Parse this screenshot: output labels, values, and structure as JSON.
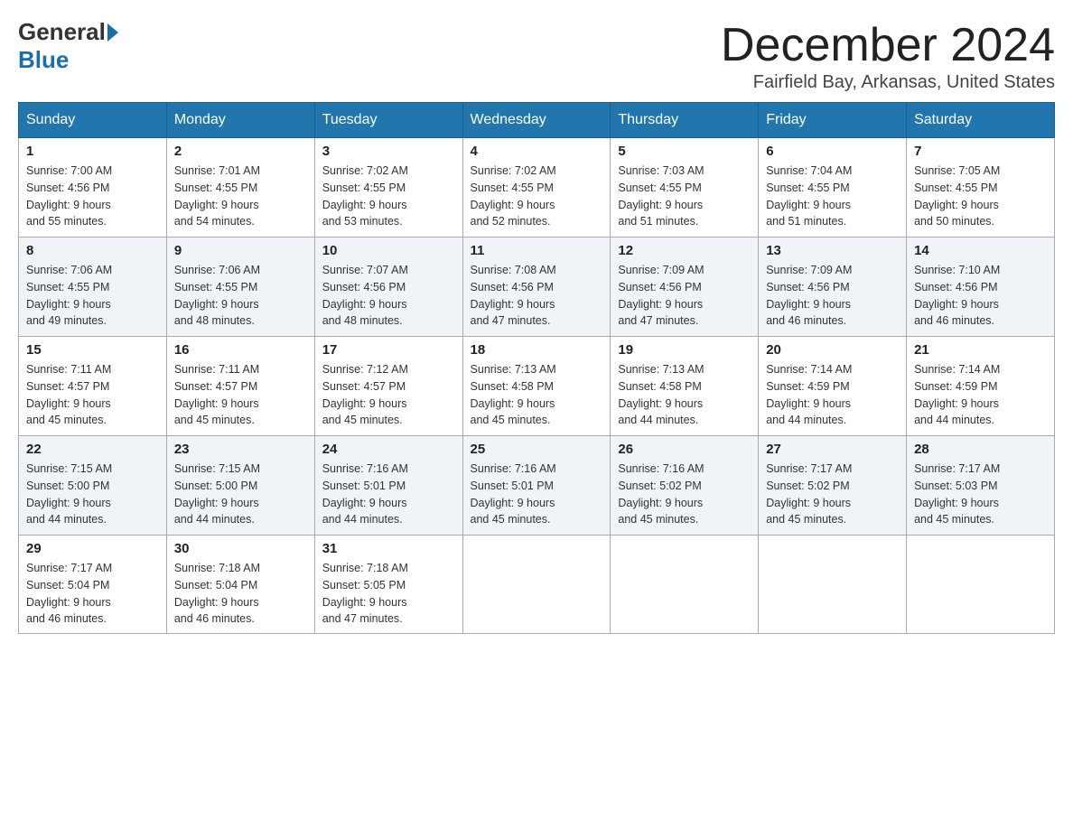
{
  "header": {
    "logo_general": "General",
    "logo_blue": "Blue",
    "title": "December 2024",
    "subtitle": "Fairfield Bay, Arkansas, United States"
  },
  "weekdays": [
    "Sunday",
    "Monday",
    "Tuesday",
    "Wednesday",
    "Thursday",
    "Friday",
    "Saturday"
  ],
  "weeks": [
    [
      {
        "day": "1",
        "sunrise": "7:00 AM",
        "sunset": "4:56 PM",
        "daylight": "9 hours and 55 minutes."
      },
      {
        "day": "2",
        "sunrise": "7:01 AM",
        "sunset": "4:55 PM",
        "daylight": "9 hours and 54 minutes."
      },
      {
        "day": "3",
        "sunrise": "7:02 AM",
        "sunset": "4:55 PM",
        "daylight": "9 hours and 53 minutes."
      },
      {
        "day": "4",
        "sunrise": "7:02 AM",
        "sunset": "4:55 PM",
        "daylight": "9 hours and 52 minutes."
      },
      {
        "day": "5",
        "sunrise": "7:03 AM",
        "sunset": "4:55 PM",
        "daylight": "9 hours and 51 minutes."
      },
      {
        "day": "6",
        "sunrise": "7:04 AM",
        "sunset": "4:55 PM",
        "daylight": "9 hours and 51 minutes."
      },
      {
        "day": "7",
        "sunrise": "7:05 AM",
        "sunset": "4:55 PM",
        "daylight": "9 hours and 50 minutes."
      }
    ],
    [
      {
        "day": "8",
        "sunrise": "7:06 AM",
        "sunset": "4:55 PM",
        "daylight": "9 hours and 49 minutes."
      },
      {
        "day": "9",
        "sunrise": "7:06 AM",
        "sunset": "4:55 PM",
        "daylight": "9 hours and 48 minutes."
      },
      {
        "day": "10",
        "sunrise": "7:07 AM",
        "sunset": "4:56 PM",
        "daylight": "9 hours and 48 minutes."
      },
      {
        "day": "11",
        "sunrise": "7:08 AM",
        "sunset": "4:56 PM",
        "daylight": "9 hours and 47 minutes."
      },
      {
        "day": "12",
        "sunrise": "7:09 AM",
        "sunset": "4:56 PM",
        "daylight": "9 hours and 47 minutes."
      },
      {
        "day": "13",
        "sunrise": "7:09 AM",
        "sunset": "4:56 PM",
        "daylight": "9 hours and 46 minutes."
      },
      {
        "day": "14",
        "sunrise": "7:10 AM",
        "sunset": "4:56 PM",
        "daylight": "9 hours and 46 minutes."
      }
    ],
    [
      {
        "day": "15",
        "sunrise": "7:11 AM",
        "sunset": "4:57 PM",
        "daylight": "9 hours and 45 minutes."
      },
      {
        "day": "16",
        "sunrise": "7:11 AM",
        "sunset": "4:57 PM",
        "daylight": "9 hours and 45 minutes."
      },
      {
        "day": "17",
        "sunrise": "7:12 AM",
        "sunset": "4:57 PM",
        "daylight": "9 hours and 45 minutes."
      },
      {
        "day": "18",
        "sunrise": "7:13 AM",
        "sunset": "4:58 PM",
        "daylight": "9 hours and 45 minutes."
      },
      {
        "day": "19",
        "sunrise": "7:13 AM",
        "sunset": "4:58 PM",
        "daylight": "9 hours and 44 minutes."
      },
      {
        "day": "20",
        "sunrise": "7:14 AM",
        "sunset": "4:59 PM",
        "daylight": "9 hours and 44 minutes."
      },
      {
        "day": "21",
        "sunrise": "7:14 AM",
        "sunset": "4:59 PM",
        "daylight": "9 hours and 44 minutes."
      }
    ],
    [
      {
        "day": "22",
        "sunrise": "7:15 AM",
        "sunset": "5:00 PM",
        "daylight": "9 hours and 44 minutes."
      },
      {
        "day": "23",
        "sunrise": "7:15 AM",
        "sunset": "5:00 PM",
        "daylight": "9 hours and 44 minutes."
      },
      {
        "day": "24",
        "sunrise": "7:16 AM",
        "sunset": "5:01 PM",
        "daylight": "9 hours and 44 minutes."
      },
      {
        "day": "25",
        "sunrise": "7:16 AM",
        "sunset": "5:01 PM",
        "daylight": "9 hours and 45 minutes."
      },
      {
        "day": "26",
        "sunrise": "7:16 AM",
        "sunset": "5:02 PM",
        "daylight": "9 hours and 45 minutes."
      },
      {
        "day": "27",
        "sunrise": "7:17 AM",
        "sunset": "5:02 PM",
        "daylight": "9 hours and 45 minutes."
      },
      {
        "day": "28",
        "sunrise": "7:17 AM",
        "sunset": "5:03 PM",
        "daylight": "9 hours and 45 minutes."
      }
    ],
    [
      {
        "day": "29",
        "sunrise": "7:17 AM",
        "sunset": "5:04 PM",
        "daylight": "9 hours and 46 minutes."
      },
      {
        "day": "30",
        "sunrise": "7:18 AM",
        "sunset": "5:04 PM",
        "daylight": "9 hours and 46 minutes."
      },
      {
        "day": "31",
        "sunrise": "7:18 AM",
        "sunset": "5:05 PM",
        "daylight": "9 hours and 47 minutes."
      },
      null,
      null,
      null,
      null
    ]
  ],
  "labels": {
    "sunrise": "Sunrise:",
    "sunset": "Sunset:",
    "daylight": "Daylight:"
  }
}
